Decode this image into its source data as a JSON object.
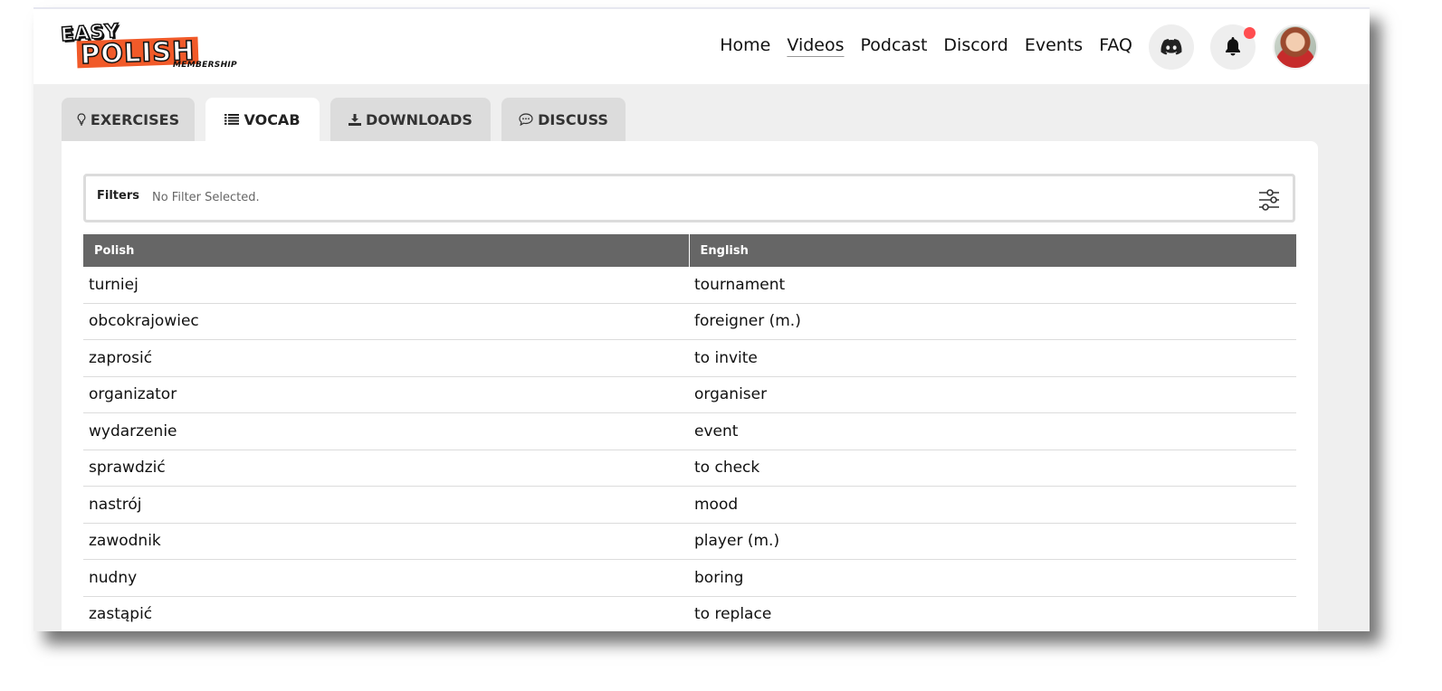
{
  "logo": {
    "easy": "EASY",
    "polish": "POLISH",
    "membership": "MEMBERSHIP"
  },
  "nav": {
    "links": [
      {
        "label": "Home",
        "active": false
      },
      {
        "label": "Videos",
        "active": true
      },
      {
        "label": "Podcast",
        "active": false
      },
      {
        "label": "Discord",
        "active": false
      },
      {
        "label": "Events",
        "active": false
      },
      {
        "label": "FAQ",
        "active": false
      }
    ],
    "icons": [
      "discord-icon",
      "bell-icon",
      "avatar"
    ],
    "notification_color": "#ff4d4f"
  },
  "tabs": [
    {
      "label": "EXERCISES",
      "icon": "lightbulb-icon",
      "active": false
    },
    {
      "label": "VOCAB",
      "icon": "list-icon",
      "active": true
    },
    {
      "label": "DOWNLOADS",
      "icon": "download-icon",
      "active": false
    },
    {
      "label": "DISCUSS",
      "icon": "chat-icon",
      "active": false
    }
  ],
  "filters": {
    "label": "Filters",
    "value": "No Filter Selected.",
    "icon": "sliders-icon"
  },
  "table": {
    "headers": [
      "Polish",
      "English"
    ],
    "rows": [
      [
        "turniej",
        "tournament"
      ],
      [
        "obcokrajowiec",
        "foreigner (m.)"
      ],
      [
        "zaprosić",
        "to invite"
      ],
      [
        "organizator",
        "organiser"
      ],
      [
        "wydarzenie",
        "event"
      ],
      [
        "sprawdzić",
        "to check"
      ],
      [
        "nastrój",
        "mood"
      ],
      [
        "zawodnik",
        "player (m.)"
      ],
      [
        "nudny",
        "boring"
      ],
      [
        "zastąpić",
        "to replace"
      ]
    ]
  },
  "colors": {
    "header_bg": "#666666",
    "accent_orange": "#f15a29",
    "page_bg": "#efefef"
  }
}
